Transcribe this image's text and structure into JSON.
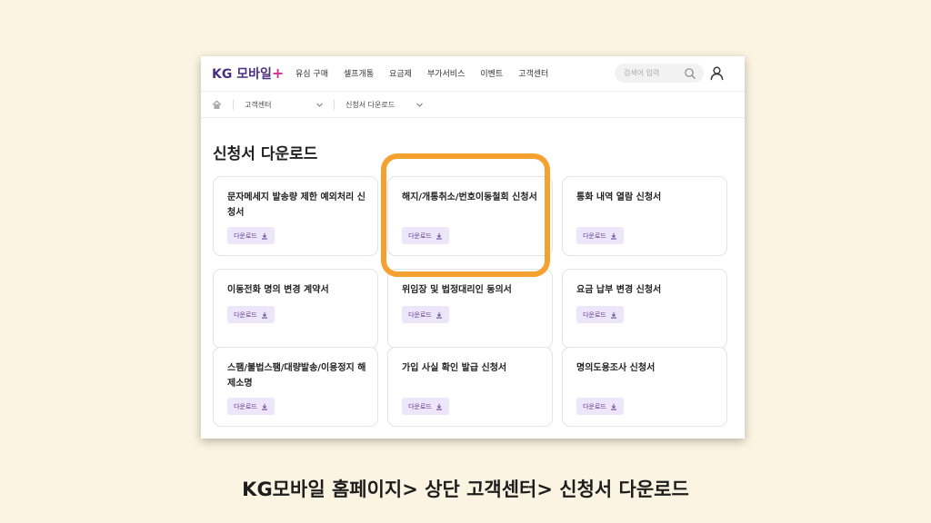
{
  "header": {
    "logo_text": "KG 모바일",
    "logo_mark": "+",
    "nav": [
      "유심 구매",
      "셀프개통",
      "요금제",
      "부가서비스",
      "이벤트",
      "고객센터"
    ],
    "search_placeholder": "검색어 입력",
    "icons": [
      "search-icon",
      "user-icon"
    ]
  },
  "breadcrumb": {
    "home_icon": "home-icon",
    "level1": "고객센터",
    "level2": "신청서 다운로드"
  },
  "main": {
    "title": "신청서 다운로드",
    "download_label": "다운로드",
    "cards": [
      {
        "title": "문자메세지 발송량 제한 예외처리 신청서"
      },
      {
        "title": "해지/개통취소/번호이동철회 신청서"
      },
      {
        "title": "통화 내역 열람 신청서"
      },
      {
        "title": "이동전화 명의 변경 계약서"
      },
      {
        "title": "위임장 및 법정대리인 동의서"
      },
      {
        "title": "요금 납부 변경 신청서"
      },
      {
        "title": "스팸/불법스팸/대량발송/이용정지 해제소명"
      },
      {
        "title": "가입 사실 확인 발급 신청서"
      },
      {
        "title": "명의도용조사 신청서"
      }
    ]
  },
  "caption": "KG모바일 홈페이지> 상단 고객센터> 신청서 다운로드",
  "colors": {
    "background": "#fcf4e2",
    "brand": "#4a2f7f",
    "brand_accent": "#d62f8f",
    "download_button_bg": "#ede6fa",
    "highlight": "#f4a12f"
  }
}
